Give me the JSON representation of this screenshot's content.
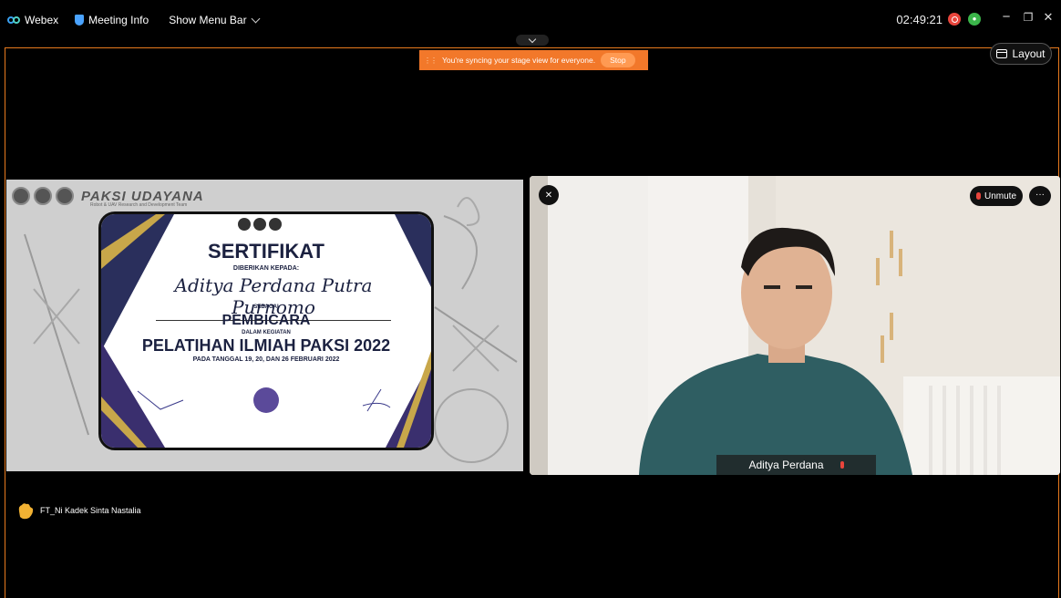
{
  "topbar": {
    "app_name": "Webex",
    "meeting_info": "Meeting Info",
    "show_menu_bar": "Show Menu Bar",
    "clock": "02:49:21",
    "minimize": "−",
    "maximize": "❐",
    "close": "✕"
  },
  "banner": {
    "message": "You're syncing your stage view for everyone.",
    "stop": "Stop"
  },
  "layout_button": "Layout",
  "shared": {
    "org_title": "PAKSI UDAYANA",
    "org_subtitle": "Robot & UAV Research and Development Team",
    "cert_title": "SERTIFIKAT",
    "given_to": "DIBERIKAN KEPADA:",
    "recipient": "Aditya Perdana Putra Purnomo",
    "as_label": "SEBAGAI",
    "role": "PEMBICARA",
    "in_label": "DALAM KEGIATAN",
    "event": "PELATIHAN ILMIAH PAKSI 2022",
    "date": "PADA TANGGAL 19, 20, DAN 26 FEBRUARI 2022"
  },
  "video": {
    "unmute": "Unmute",
    "more": "···",
    "name": "Aditya Perdana"
  },
  "participants": [
    {
      "name": "FT_Ni Kadek Sinta Nastalia"
    }
  ],
  "colors": {
    "accent": "#f2782a",
    "frame": "#e87a1e",
    "mute": "#e8453c"
  }
}
